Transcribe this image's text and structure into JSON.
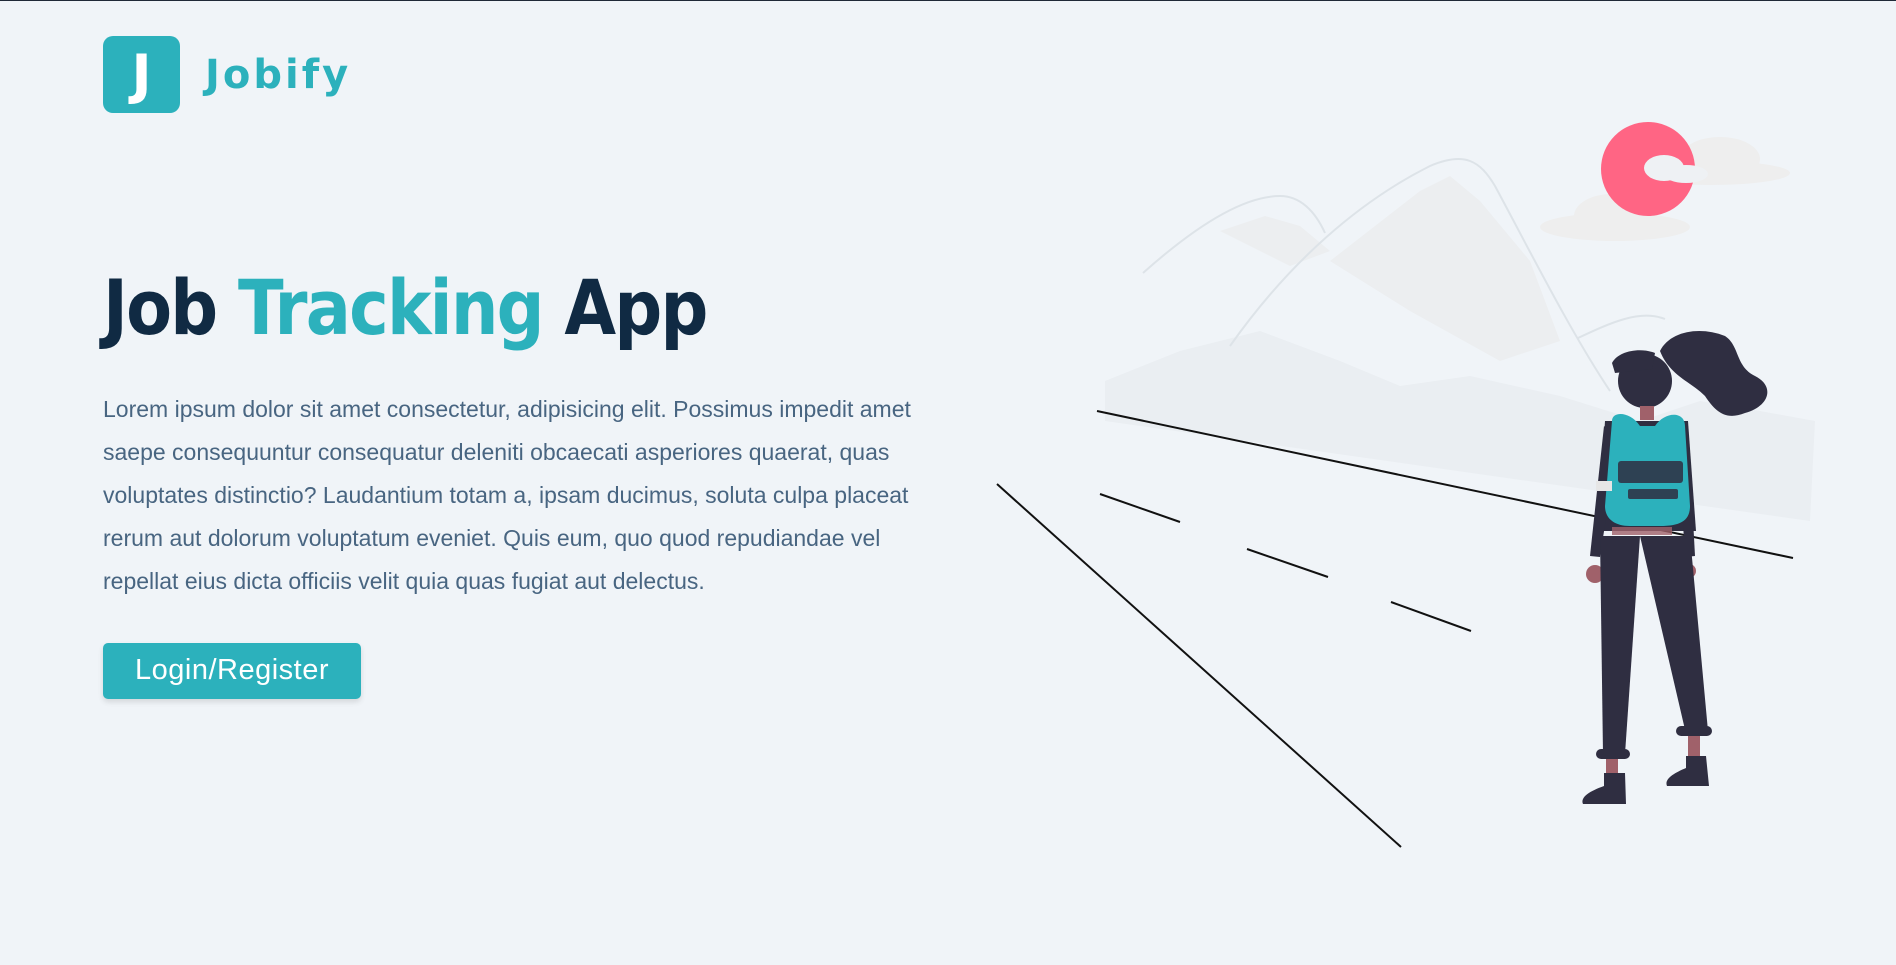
{
  "nav": {
    "logo_letter": "J",
    "logo_text": "Jobify"
  },
  "hero": {
    "title_part1": "Job ",
    "title_accent": "Tracking",
    "title_part2": " App",
    "description": "Lorem ipsum dolor sit amet consectetur, adipisicing elit. Possimus impedit amet saepe consequuntur consequatur deleniti obcaecati asperiores quaerat, quas voluptates distinctio? Laudantium totam a, ipsam ducimus, soluta culpa placeat rerum aut dolorum voluptatum eveniet. Quis eum, quo quod repudiandae vel repellat eius dicta officiis velit quia quas fugiat aut delectus.",
    "cta_label": "Login/Register"
  },
  "colors": {
    "primary": "#2cb1bc",
    "heading": "#102a43",
    "body_text": "#486581",
    "background": "#f0f4f8",
    "sun": "#ff6584"
  },
  "illustration": {
    "icon": "traveler-on-road-illustration"
  }
}
